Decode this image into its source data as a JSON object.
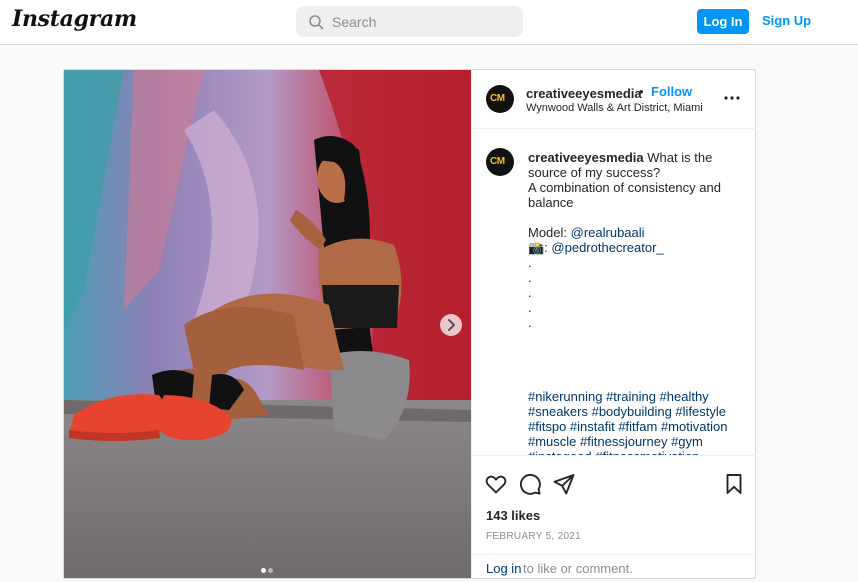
{
  "header": {
    "logo": "Instagram",
    "search_placeholder": "Search",
    "login_label": "Log In",
    "signup_label": "Sign Up"
  },
  "post": {
    "username": "creativeeyesmedia",
    "avatar_text": "CM",
    "bullet": "•",
    "follow_label": "Follow",
    "location": "Wynwood Walls & Art District, Miami",
    "caption": {
      "username": "creativeeyesmedia",
      "intro": " What is the source of my success?\nA combination of consistency and balance\n\nModel: ",
      "model_handle": "@realrubaali",
      "camera_prefix": "\n📸: ",
      "photographer_handle": "@pedrothecreator_",
      "dots": "\n.\n.\n.\n.\n.",
      "hashtags": "#nikerunning #training #healthy #sneakers #bodybuilding #lifestyle #fitspo #instafit #fitfam #motivation #muscle #fitnessjourney #gym #instagood #fitnessmotivation #photooftheday #fit #nike #nikeshoes #gymmotivation #fitnessmodel #healthylifestyle #fitnessaddict #workout #health #gymlife #fitgirl"
    },
    "likes": "143 likes",
    "date": "FEBRUARY 5, 2021",
    "login_link": "Log in",
    "comment_suffix": " to like or comment.",
    "carousel": {
      "current_slide": 1,
      "total_slides": 2
    }
  },
  "colors": {
    "brand_blue": "#0095f6",
    "link_blue": "#00376b",
    "muted": "#8e8e8e",
    "shoe_red": "#e8432f",
    "wall_red": "#b52a37"
  },
  "icons": {
    "search": "search-icon",
    "more": "more-options-icon",
    "like": "heart-icon",
    "comment": "comment-icon",
    "share": "paper-plane-icon",
    "save": "bookmark-icon",
    "next": "chevron-right-icon"
  }
}
